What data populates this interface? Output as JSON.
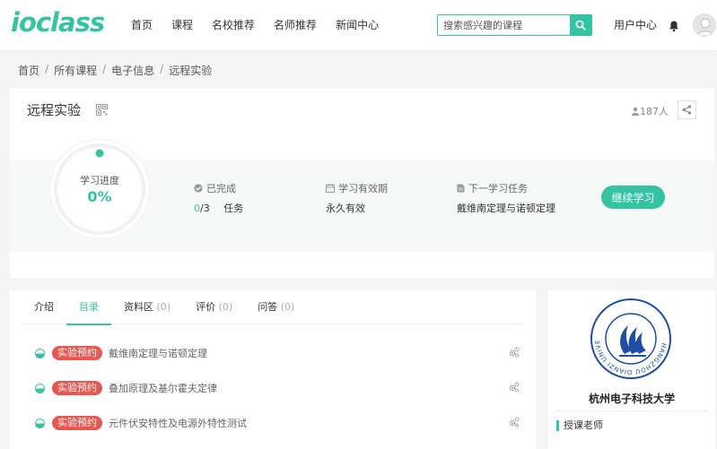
{
  "header": {
    "logo_text": "ioclass",
    "nav": [
      "首页",
      "课程",
      "名校推荐",
      "名师推荐",
      "新闻中心"
    ],
    "search_placeholder": "搜索感兴趣的课程",
    "user_center": "用户中心"
  },
  "breadcrumb": [
    "首页",
    "所有课程",
    "电子信息",
    "远程实验"
  ],
  "course": {
    "title": "远程实验",
    "students": "187人",
    "progress_label": "学习进度",
    "progress_value": "0%",
    "progress_fraction": 0,
    "completed_label": "已完成",
    "completed_done": "0",
    "completed_total": "/3",
    "completed_unit": "任务",
    "validity_label": "学习有效期",
    "validity_value": "永久有效",
    "next_label": "下一学习任务",
    "next_value": "戴维南定理与诺顿定理",
    "continue_button": "继续学习"
  },
  "tabs": [
    {
      "label": "介绍",
      "count": ""
    },
    {
      "label": "目录",
      "count": ""
    },
    {
      "label": "资料区",
      "count": "(0)"
    },
    {
      "label": "评价",
      "count": "(0)"
    },
    {
      "label": "问答",
      "count": "(0)"
    }
  ],
  "lessons": [
    {
      "tag": "实验预约",
      "name": "戴维南定理与诺顿定理"
    },
    {
      "tag": "实验预约",
      "name": "叠加原理及基尔霍夫定律"
    },
    {
      "tag": "实验预约",
      "name": "元件伏安特性及电源外特性测试"
    }
  ],
  "school": {
    "name": "杭州电子科技大学",
    "teacher_label": "授课老师",
    "logo_ring_text": "HANGZHOU DIANZI UNIVERSITY"
  },
  "colors": {
    "accent": "#35c4a3",
    "tag": "#e95650",
    "school_blue": "#1f4ea3"
  }
}
